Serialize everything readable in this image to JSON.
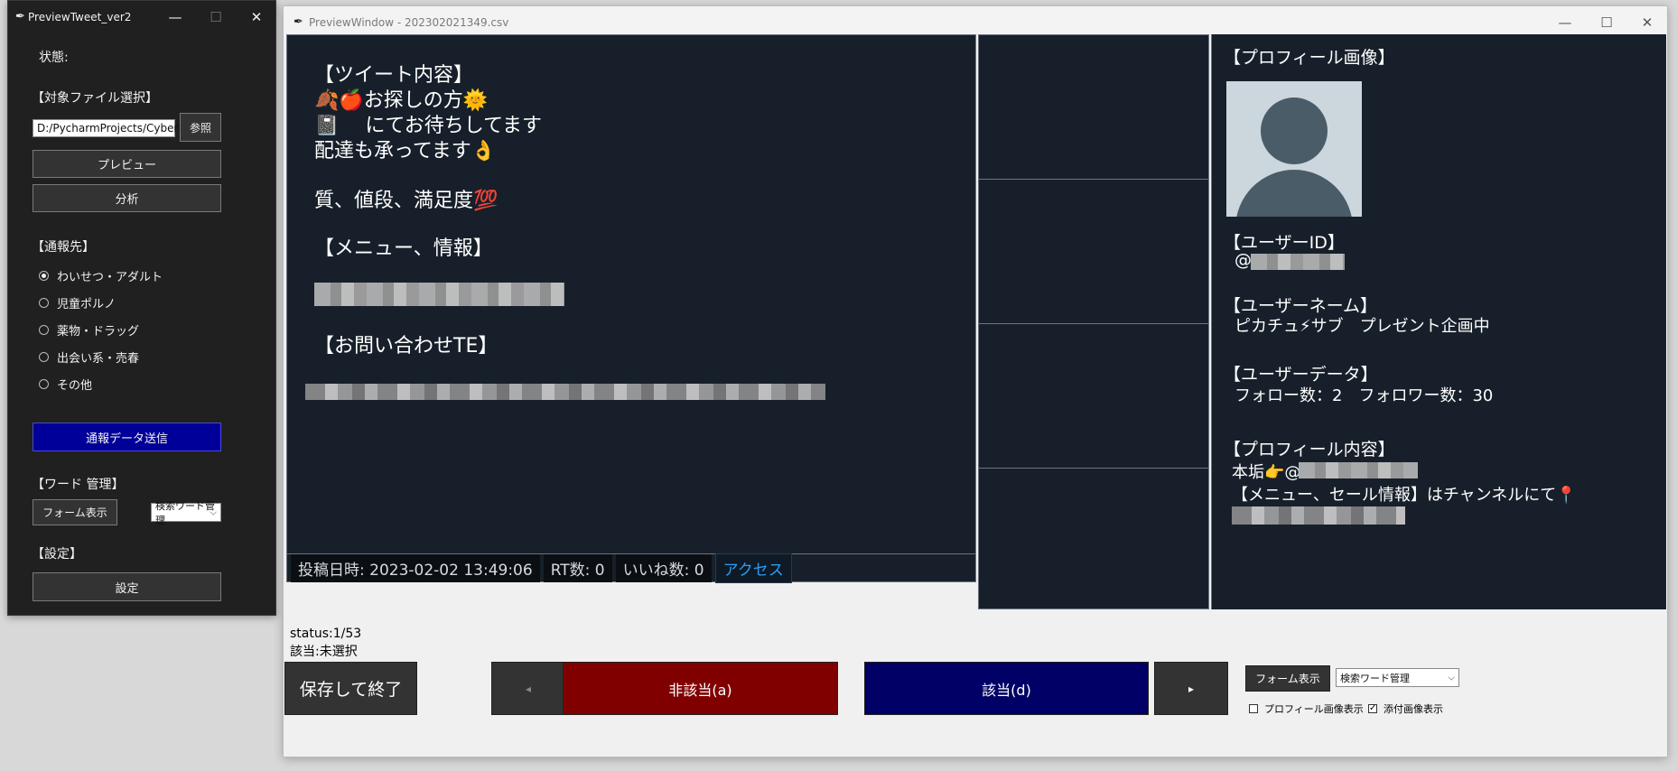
{
  "left_window": {
    "title": "PreviewTweet_ver2",
    "status_label": "状態:",
    "file_section": "【対象ファイル選択】",
    "file_path": "D:/PycharmProjects/CyberPatrolPr",
    "browse_button": "参照",
    "preview_button": "プレビュー",
    "analyze_button": "分析",
    "report_section": "【通報先】",
    "report_options": [
      "わいせつ・アダルト",
      "児童ポルノ",
      "薬物・ドラッグ",
      "出会い系・売春",
      "その他"
    ],
    "selected_option_index": 0,
    "send_button": "通報データ送信",
    "word_section": "【ワード 管理】",
    "form_button": "フォーム表示",
    "word_select": "検索ワード管理",
    "settings_section": "【設定】",
    "settings_button": "設定"
  },
  "preview_window": {
    "title": "PreviewWindow - 202302021349.csv",
    "tweet": {
      "heading": "【ツイート内容】",
      "line1": "🍂🍎お探しの方🌞",
      "line2": "📓　 にてお待ちしてます",
      "line3": "配達も承ってます👌",
      "line4": "質、値段、満足度💯",
      "menu_heading": "【メニュー、情報】",
      "contact_heading": "【お問い合わせTE】"
    },
    "status_bar": {
      "posted": "投稿日時: 2023-02-02 13:49:06",
      "rt": "RT数: 0",
      "likes": "いいね数: 0",
      "access": "アクセス"
    },
    "profile": {
      "image_heading": "【プロフィール画像】",
      "userid_heading": "【ユーザーID】",
      "userid_prefix": "@",
      "username_heading": "【ユーザーネーム】",
      "username": "ピカチュ⚡サブ　プレゼント企画中",
      "userdata_heading": "【ユーザーデータ】",
      "follow_counts": "フォロー数：2　フォロワー数：30",
      "content_heading": "【プロフィール内容】",
      "content_line1": "本垢👉@",
      "content_line2": "【メニュー、セール情報】はチャンネルにて📍"
    },
    "bottom": {
      "status": "status:1/53",
      "match": "該当:未選択",
      "save_exit": "保存して終了",
      "prev": "◂",
      "not_applicable": "非該当(a)",
      "applicable": "該当(d)",
      "next": "▸",
      "form_button": "フォーム表示",
      "word_select": "検索ワード管理",
      "profile_image_check": "プロフィール画像表示",
      "attached_image_check": "添付画像表示",
      "profile_image_checked": false,
      "attached_image_checked": true
    },
    "colors": {
      "panel_bg": "#17202a",
      "not_applicable_bg": "#800000",
      "applicable_bg": "#000066",
      "send_bg": "#000099",
      "access_link": "#2a9df4"
    }
  }
}
